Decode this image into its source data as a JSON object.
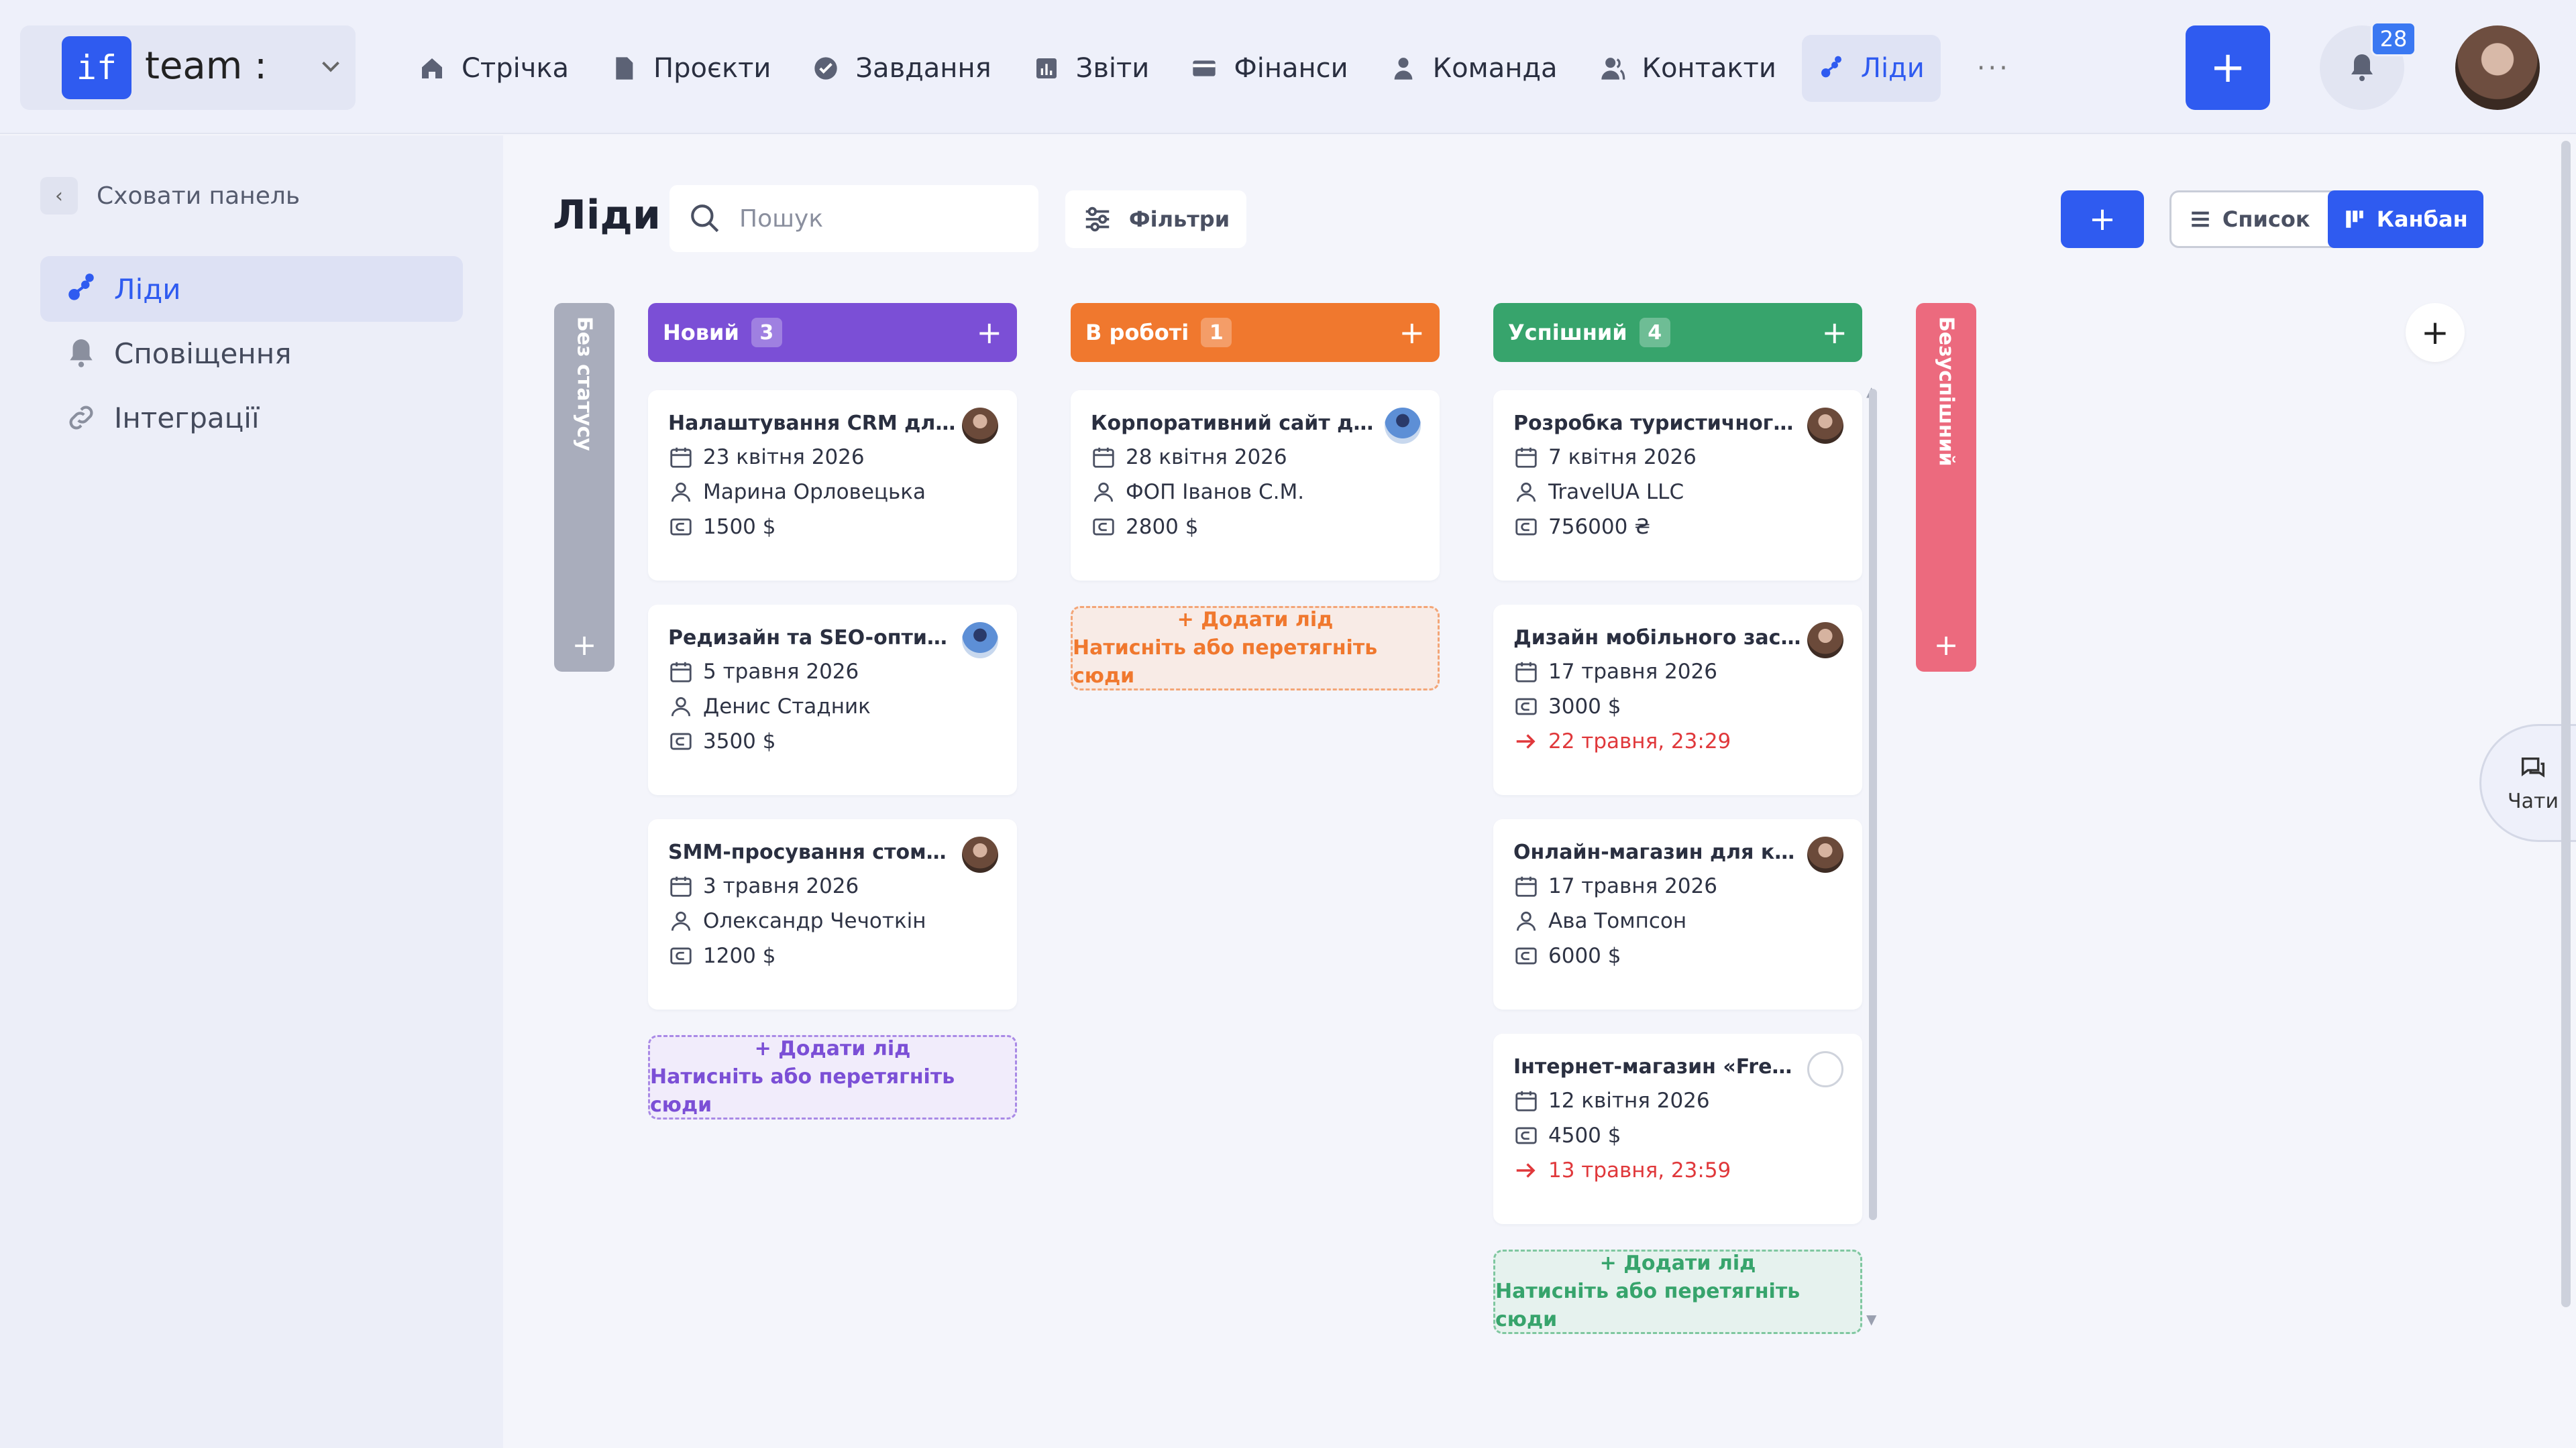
{
  "brand": {
    "logo": "if",
    "name": "team :"
  },
  "nav": [
    {
      "label": "Стрічка",
      "icon": "home-icon"
    },
    {
      "label": "Проєкти",
      "icon": "file-icon"
    },
    {
      "label": "Завдання",
      "icon": "check-circle-icon"
    },
    {
      "label": "Звіти",
      "icon": "chart-icon"
    },
    {
      "label": "Фінанси",
      "icon": "card-icon"
    },
    {
      "label": "Команда",
      "icon": "person-icon"
    },
    {
      "label": "Контакти",
      "icon": "contacts-icon"
    },
    {
      "label": "Ліди",
      "icon": "leads-icon",
      "active": true
    }
  ],
  "nav_more": "···",
  "notifications": {
    "count": "28"
  },
  "sidebar": {
    "hide": "Сховати панель",
    "items": [
      {
        "label": "Ліди",
        "icon": "leads-icon",
        "active": true
      },
      {
        "label": "Сповіщення",
        "icon": "bell-icon"
      },
      {
        "label": "Інтеграції",
        "icon": "link-icon"
      }
    ]
  },
  "page": {
    "title": "Ліди",
    "search_placeholder": "Пошук",
    "filters": "Фільтри",
    "add": "+",
    "view": {
      "list": "Список",
      "kanban": "Канбан"
    }
  },
  "columns": {
    "no_status": {
      "title": "Без статусу",
      "color": "#a9adbc"
    },
    "new": {
      "title": "Новий",
      "count": "3",
      "color": "#7b4fd6",
      "cards": [
        {
          "title": "Налаштування CRM для від...",
          "date": "23 квітня 2026",
          "person": "Марина Орловецька",
          "amount": "1500 $"
        },
        {
          "title": "Редизайн та SEO-оптиміза...",
          "date": "5 травня 2026",
          "person": "Денис Стадник",
          "amount": "3500 $"
        },
        {
          "title": "SMM-просування стомато...",
          "date": "3 травня 2026",
          "person": "Олександр Чечоткін",
          "amount": "1200 $"
        }
      ],
      "add_line1": "+ Додати лід",
      "add_line2": "Натисніть або перетягніть сюди"
    },
    "in_work": {
      "title": "В роботі",
      "count": "1",
      "color": "#f0782e",
      "cards": [
        {
          "title": "Корпоративний сайт для л...",
          "date": "28 квітня 2026",
          "person": "ФОП Іванов С.М.",
          "amount": "2800 $"
        }
      ],
      "add_line1": "+ Додати лід",
      "add_line2": "Натисніть або перетягніть сюди"
    },
    "success": {
      "title": "Успішний",
      "count": "4",
      "color": "#37a46c",
      "cards": [
        {
          "title": "Розробка туристичного ве...",
          "date": "7 квітня 2026",
          "person": "TravelUA LLC",
          "amount": "756000 ₴"
        },
        {
          "title": "Дизайн мобільного застос...",
          "date": "17 травня 2026",
          "amount": "3000 $",
          "deadline": "22 травня, 23:29"
        },
        {
          "title": "Онлайн-магазин для косме...",
          "date": "17 травня 2026",
          "person": "Ава Томпсон",
          "amount": "6000 $"
        },
        {
          "title": "Інтернет-магазин «FreshM...",
          "date": "12 квітня 2026",
          "amount": "4500 $",
          "deadline": "13 травня, 23:59"
        }
      ],
      "add_line1": "+ Додати лід",
      "add_line2": "Натисніть або перетягніть сюди"
    },
    "failed": {
      "title": "Безуспішний",
      "color": "#ec6a7e"
    }
  },
  "chats": "Чати"
}
